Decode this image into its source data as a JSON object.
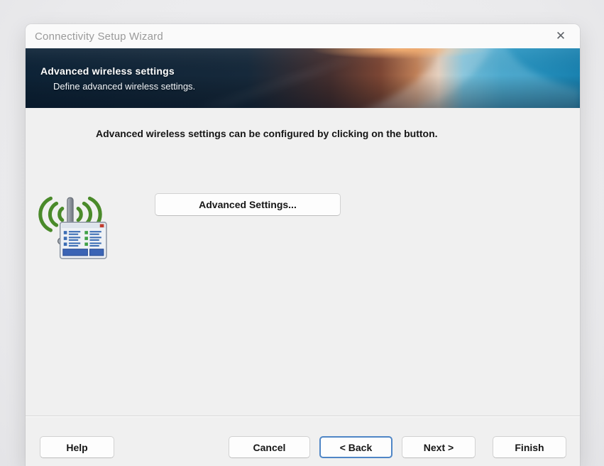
{
  "window": {
    "title": "Connectivity Setup Wizard",
    "close_glyph": "✕"
  },
  "header": {
    "title": "Advanced wireless settings",
    "subtitle": "Define advanced wireless settings."
  },
  "content": {
    "instruction": "Advanced wireless settings can be configured by clicking on the button.",
    "advanced_settings_label": "Advanced Settings...",
    "icon_name": "wireless-antenna-settings-icon"
  },
  "footer": {
    "help_label": "Help",
    "cancel_label": "Cancel",
    "back_label": "< Back",
    "next_label": "Next >",
    "finish_label": "Finish"
  },
  "colors": {
    "banner_navy": "#0d2337",
    "banner_orange": "#c08058",
    "banner_cyan": "#2b97c3",
    "focus_border": "#4f86c6",
    "icon_green": "#4a8a2a",
    "icon_blue": "#3a6cb4",
    "dialog_bg": "#f0f0f0",
    "titlebar_bg": "#fafafa",
    "title_text": "#9a9a9a"
  }
}
